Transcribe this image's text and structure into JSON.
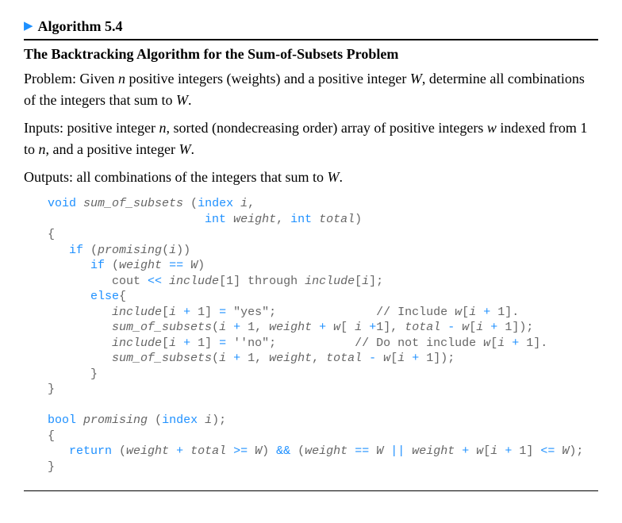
{
  "header": {
    "triangle": "▶",
    "title": "Algorithm 5.4"
  },
  "subtitle": "The Backtracking Algorithm for the Sum-of-Subsets Problem",
  "problem": {
    "label": "Problem: Given ",
    "n": "n",
    "mid1": " positive integers (weights) and a positive integer ",
    "W": "W",
    "mid2": ", determine all combinations of the integers that sum to ",
    "end": "."
  },
  "inputs": {
    "label": "Inputs: positive integer ",
    "n": "n",
    "mid1": ", sorted (nondecreasing order) array of positive integers ",
    "w": "w",
    "mid2": " indexed from 1 to ",
    "n2": "n",
    "mid3": ", and a positive integer ",
    "W": "W",
    "end": "."
  },
  "outputs": {
    "label": "Outputs: all combinations of the integers that sum to ",
    "W": "W",
    "end": "."
  },
  "code": {
    "l1a": "void",
    "l1b": " sum_of_subsets ",
    "l1c": "(",
    "l1d": "index",
    "l1e": " i",
    "l1f": ",",
    "l2a": "                      ",
    "l2b": "int",
    "l2c": " weight",
    "l2d": ", ",
    "l2e": "int",
    "l2f": " total",
    "l2g": ")",
    "l3": "{",
    "l4a": "   ",
    "l4b": "if",
    "l4c": " (",
    "l4d": "promising",
    "l4e": "(",
    "l4f": "i",
    "l4g": "))",
    "l5a": "      ",
    "l5b": "if",
    "l5c": " (",
    "l5d": "weight ",
    "l5e": "==",
    "l5f": " W",
    "l5g": ")",
    "l6a": "         cout ",
    "l6b": "<<",
    "l6c": " include",
    "l6d": "[1] through ",
    "l6e": "include",
    "l6f": "[",
    "l6g": "i",
    "l6h": "];",
    "l7a": "      ",
    "l7b": "else",
    "l7c": "{",
    "l8a": "         ",
    "l8b": "include",
    "l8c": "[",
    "l8d": "i ",
    "l8e": "+",
    "l8f": " 1] ",
    "l8g": "=",
    "l8h": " \"yes\";              // Include ",
    "l8i": "w",
    "l8j": "[",
    "l8k": "i ",
    "l8l": "+",
    "l8m": " 1].",
    "l9a": "         ",
    "l9b": "sum_of_subsets",
    "l9c": "(",
    "l9d": "i ",
    "l9e": "+",
    "l9f": " 1, ",
    "l9g": "weight ",
    "l9h": "+",
    "l9i": " w",
    "l9j": "[ ",
    "l9k": "i ",
    "l9l": "+",
    "l9m": "1], ",
    "l9n": "total ",
    "l9o": "-",
    "l9p": " w",
    "l9q": "[",
    "l9r": "i ",
    "l9s": "+",
    "l9t": " 1]);",
    "l10a": "         ",
    "l10b": "include",
    "l10c": "[",
    "l10d": "i ",
    "l10e": "+",
    "l10f": " 1] ",
    "l10g": "=",
    "l10h": " ''no\";           // Do not include ",
    "l10i": "w",
    "l10j": "[",
    "l10k": "i ",
    "l10l": "+",
    "l10m": " 1].",
    "l11a": "         ",
    "l11b": "sum_of_subsets",
    "l11c": "(",
    "l11d": "i ",
    "l11e": "+",
    "l11f": " 1, ",
    "l11g": "weight",
    "l11h": ", ",
    "l11i": "total ",
    "l11j": "-",
    "l11k": " w",
    "l11l": "[",
    "l11m": "i ",
    "l11n": "+",
    "l11o": " 1]);",
    "l12": "      }",
    "l13": "}",
    "l14": "",
    "l15a": "bool",
    "l15b": " promising ",
    "l15c": "(",
    "l15d": "index",
    "l15e": " i",
    "l15f": ");",
    "l16": "{",
    "l17a": "   ",
    "l17b": "return",
    "l17c": " (",
    "l17d": "weight ",
    "l17e": "+",
    "l17f": " total ",
    "l17g": ">=",
    "l17h": " W",
    "l17i": ") ",
    "l17j": "&&",
    "l17k": " (",
    "l17l": "weight ",
    "l17m": "==",
    "l17n": " W ",
    "l17o": "||",
    "l17p": " weight ",
    "l17q": "+",
    "l17r": " w",
    "l17s": "[",
    "l17t": "i ",
    "l17u": "+",
    "l17v": " 1] ",
    "l17w": "<=",
    "l17x": " W",
    "l17y": ");",
    "l18": "}"
  }
}
